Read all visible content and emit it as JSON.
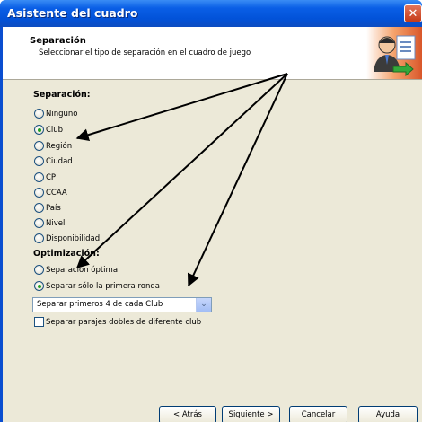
{
  "window": {
    "title": "Asistente del cuadro",
    "close_glyph": "✕"
  },
  "header": {
    "title": "Separación",
    "subtitle": "Seleccionar el tipo de separación en el cuadro de juego",
    "icon": "wizard-person-documents-icon"
  },
  "separation": {
    "heading": "Separación:",
    "options": [
      {
        "label": "Ninguno",
        "selected": false
      },
      {
        "label": "Club",
        "selected": true
      },
      {
        "label": "Región",
        "selected": false
      },
      {
        "label": "Ciudad",
        "selected": false
      },
      {
        "label": "CP",
        "selected": false
      },
      {
        "label": "CCAA",
        "selected": false
      },
      {
        "label": "País",
        "selected": false
      },
      {
        "label": "Nivel",
        "selected": false
      },
      {
        "label": "Disponibilidad",
        "selected": false
      }
    ]
  },
  "optimization": {
    "heading": "Optimización:",
    "options": [
      {
        "label": "Separación óptima",
        "selected": false
      },
      {
        "label": "Separar sólo la primera ronda",
        "selected": true
      }
    ]
  },
  "dropdown": {
    "value": "Separar primeros 4 de cada Club",
    "arrow": "⌄"
  },
  "checkbox": {
    "label": "Separar parajes dobles de diferente club",
    "checked": false
  },
  "buttons": {
    "back": "< Atrás",
    "next": "Siguiente >",
    "cancel": "Cancelar",
    "help": "Ayuda"
  }
}
